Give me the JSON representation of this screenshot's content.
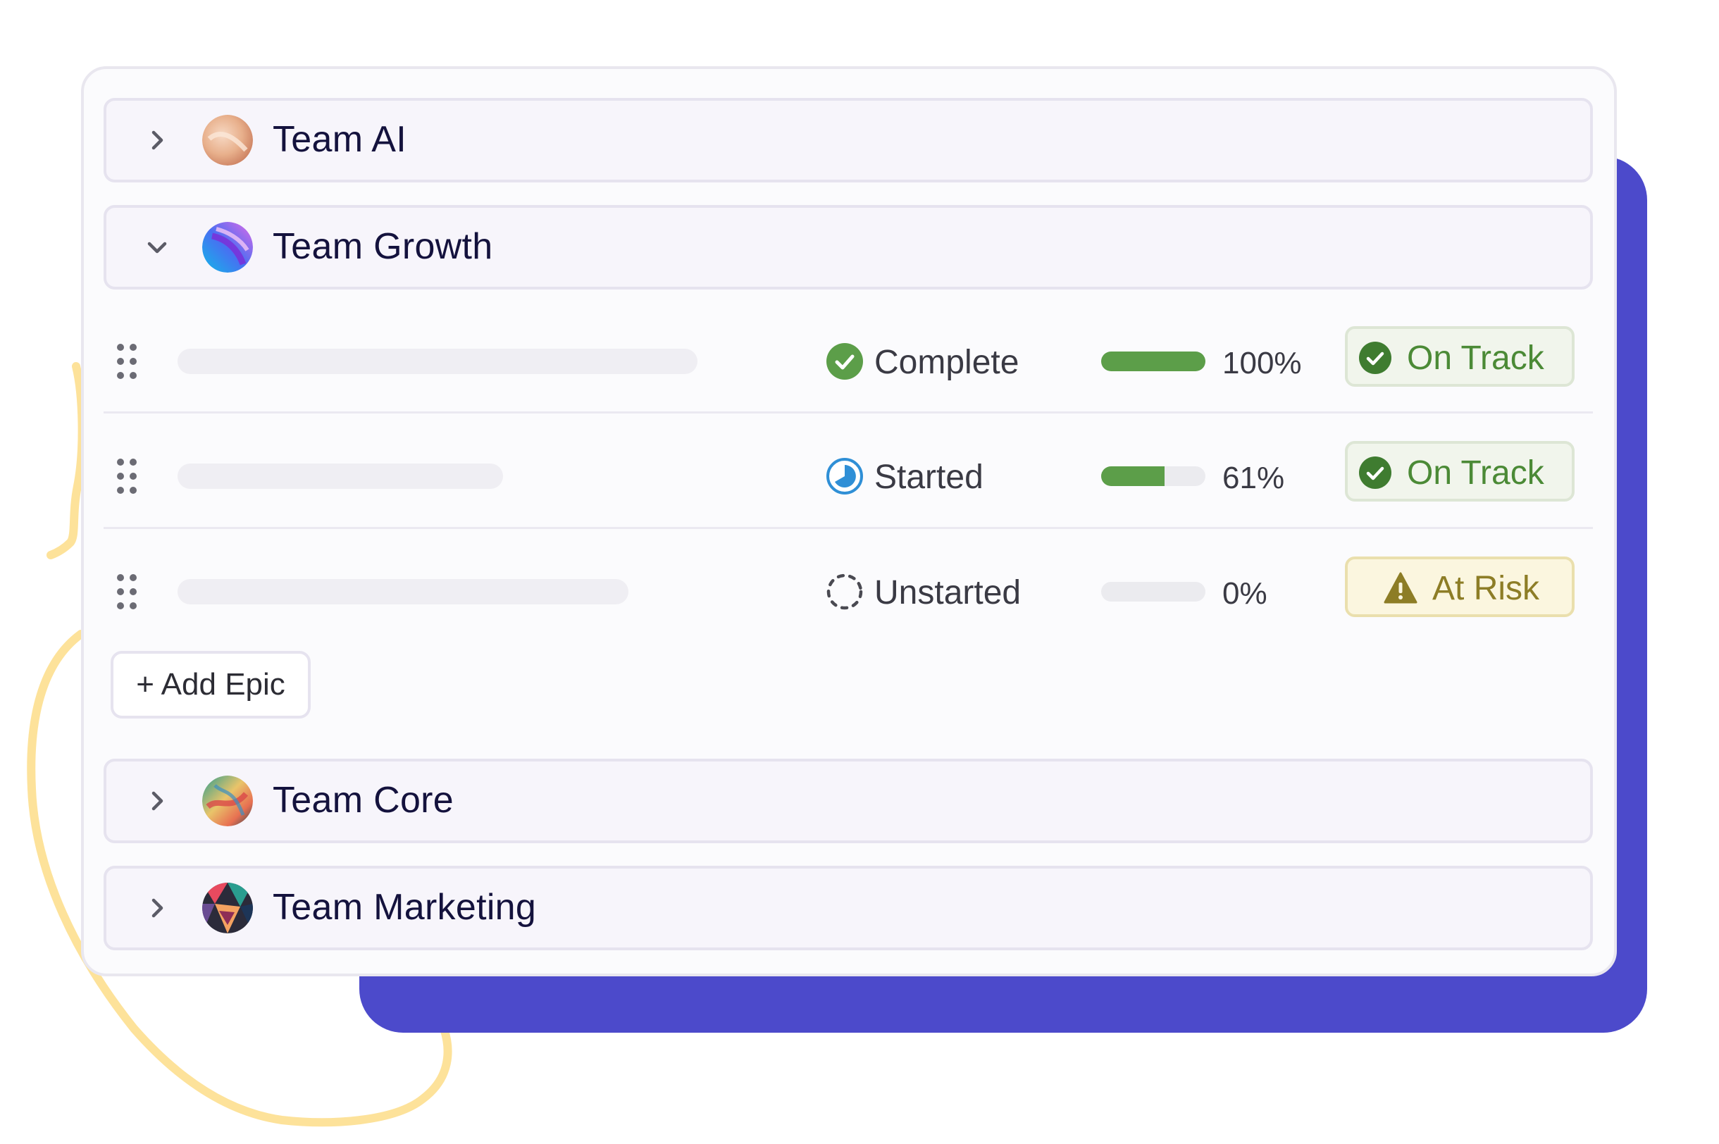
{
  "colors": {
    "accent_block": "#4c4acb",
    "squiggle": "#fde29a",
    "progress_fill": "#5c9e49",
    "on_track_text": "#4b8a36",
    "at_risk_text": "#8d7d26",
    "started_icon": "#2f8fd6"
  },
  "teams": [
    {
      "name": "Team AI",
      "expanded": false,
      "icon": "chevron-right-icon",
      "avatar": "team-ai-avatar"
    },
    {
      "name": "Team Growth",
      "expanded": true,
      "icon": "chevron-down-icon",
      "avatar": "team-growth-avatar"
    },
    {
      "name": "Team Core",
      "expanded": false,
      "icon": "chevron-right-icon",
      "avatar": "team-core-avatar"
    },
    {
      "name": "Team Marketing",
      "expanded": false,
      "icon": "chevron-right-icon",
      "avatar": "team-marketing-avatar"
    }
  ],
  "epics": [
    {
      "status": "Complete",
      "status_icon": "check-circle-icon",
      "progress": 1.0,
      "percent": "100%",
      "health": "On Track",
      "health_icon": "check-circle-icon"
    },
    {
      "status": "Started",
      "status_icon": "partial-clock-icon",
      "progress": 0.61,
      "percent": "61%",
      "health": "On Track",
      "health_icon": "check-circle-icon"
    },
    {
      "status": "Unstarted",
      "status_icon": "dashed-circle-icon",
      "progress": 0.0,
      "percent": "0%",
      "health": "At Risk",
      "health_icon": "warning-triangle-icon"
    }
  ],
  "add_epic_label": "+ Add Epic"
}
